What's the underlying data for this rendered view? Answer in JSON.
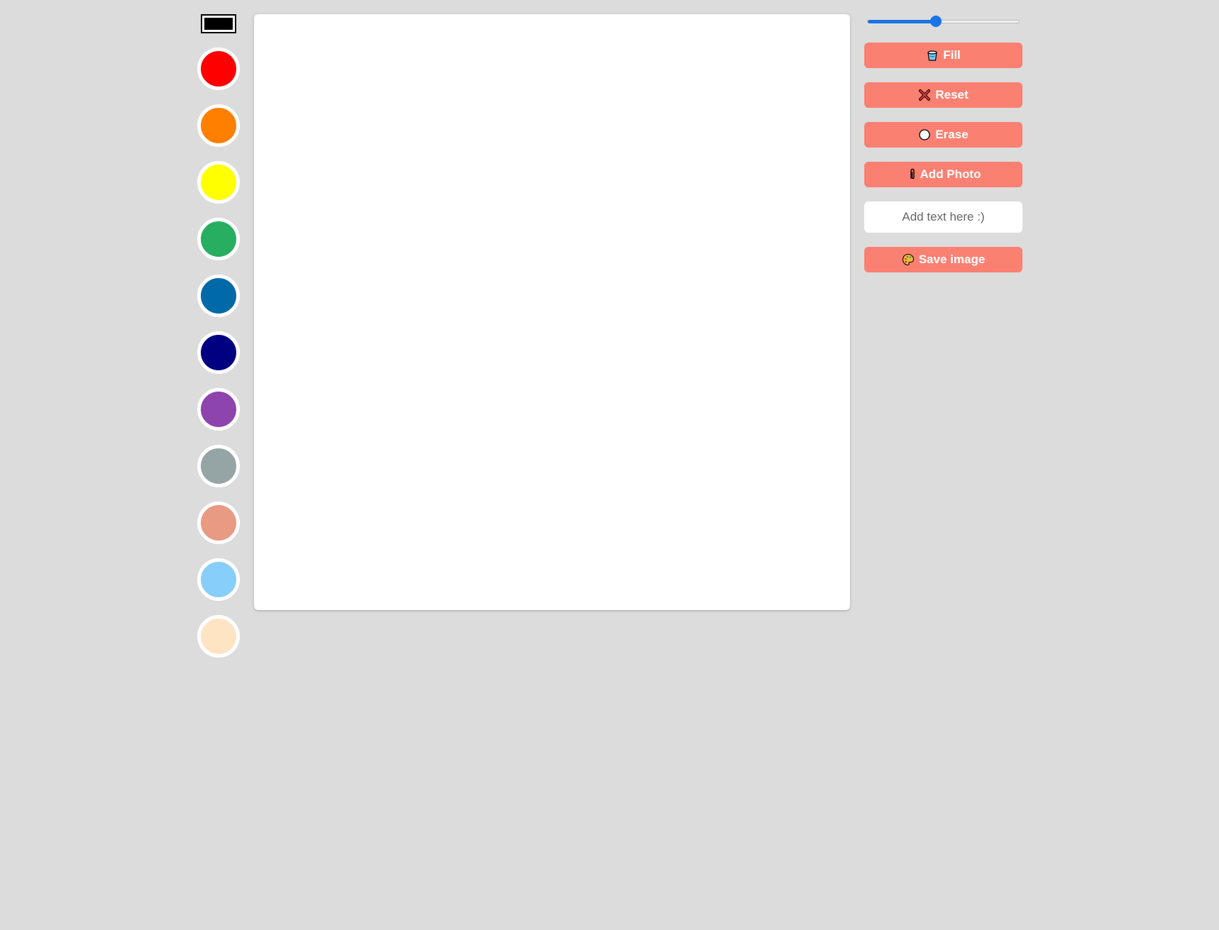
{
  "palette": {
    "picker_color": "#000000",
    "colors": [
      {
        "name": "red",
        "hex": "#ff0000"
      },
      {
        "name": "orange",
        "hex": "#ff7f00"
      },
      {
        "name": "yellow",
        "hex": "#ffff00"
      },
      {
        "name": "green",
        "hex": "#27ae60"
      },
      {
        "name": "blue",
        "hex": "#0069a8"
      },
      {
        "name": "navy",
        "hex": "#000080"
      },
      {
        "name": "purple",
        "hex": "#8e44ad"
      },
      {
        "name": "gray",
        "hex": "#95a5a6"
      },
      {
        "name": "salmon",
        "hex": "#e99a82"
      },
      {
        "name": "light-blue",
        "hex": "#87cefa"
      },
      {
        "name": "bisque",
        "hex": "#ffe4c4"
      }
    ]
  },
  "tools": {
    "brush_size_fraction": 0.45,
    "fill_label": "Fill",
    "fill_icon": "paint-bucket-icon",
    "reset_label": "Reset",
    "reset_icon": "cross-icon",
    "erase_label": "Erase",
    "erase_icon": "circle-icon",
    "add_photo_label": "Add Photo",
    "add_photo_icon": "paperclip-icon",
    "text_placeholder": "Add text here :)",
    "save_label": "Save image",
    "save_icon": "palette-icon",
    "button_color": "#fa8072"
  }
}
